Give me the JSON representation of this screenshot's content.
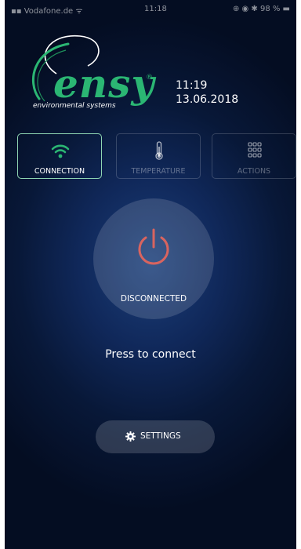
{
  "status_bar": {
    "carrier": "▪▪ Vodafone.de ᯤ",
    "time": "11:18",
    "right_icons": "⊕ ◉ ✱ 98 % ▬"
  },
  "logo": {
    "word": "ensy",
    "registered": "®",
    "tagline": "environmental systems"
  },
  "datetime": {
    "time": "11:19",
    "date": "13.06.2018"
  },
  "tabs": [
    {
      "label": "CONNECTION",
      "icon": "wifi-icon",
      "active": true
    },
    {
      "label": "TEMPERATURE",
      "icon": "thermometer-icon",
      "active": false
    },
    {
      "label": "ACTIONS",
      "icon": "grid-icon",
      "active": false
    }
  ],
  "power": {
    "status": "DISCONNECTED",
    "icon": "power-icon"
  },
  "hint": "Press to connect",
  "settings": {
    "label": "SETTINGS",
    "icon": "gear-icon"
  },
  "colors": {
    "brand_green": "#2bb673",
    "power_red": "#d9645f",
    "active_tab_border": "#8fd6b3",
    "background_dark": "#040d22",
    "background_glow": "#1b3f7a"
  }
}
